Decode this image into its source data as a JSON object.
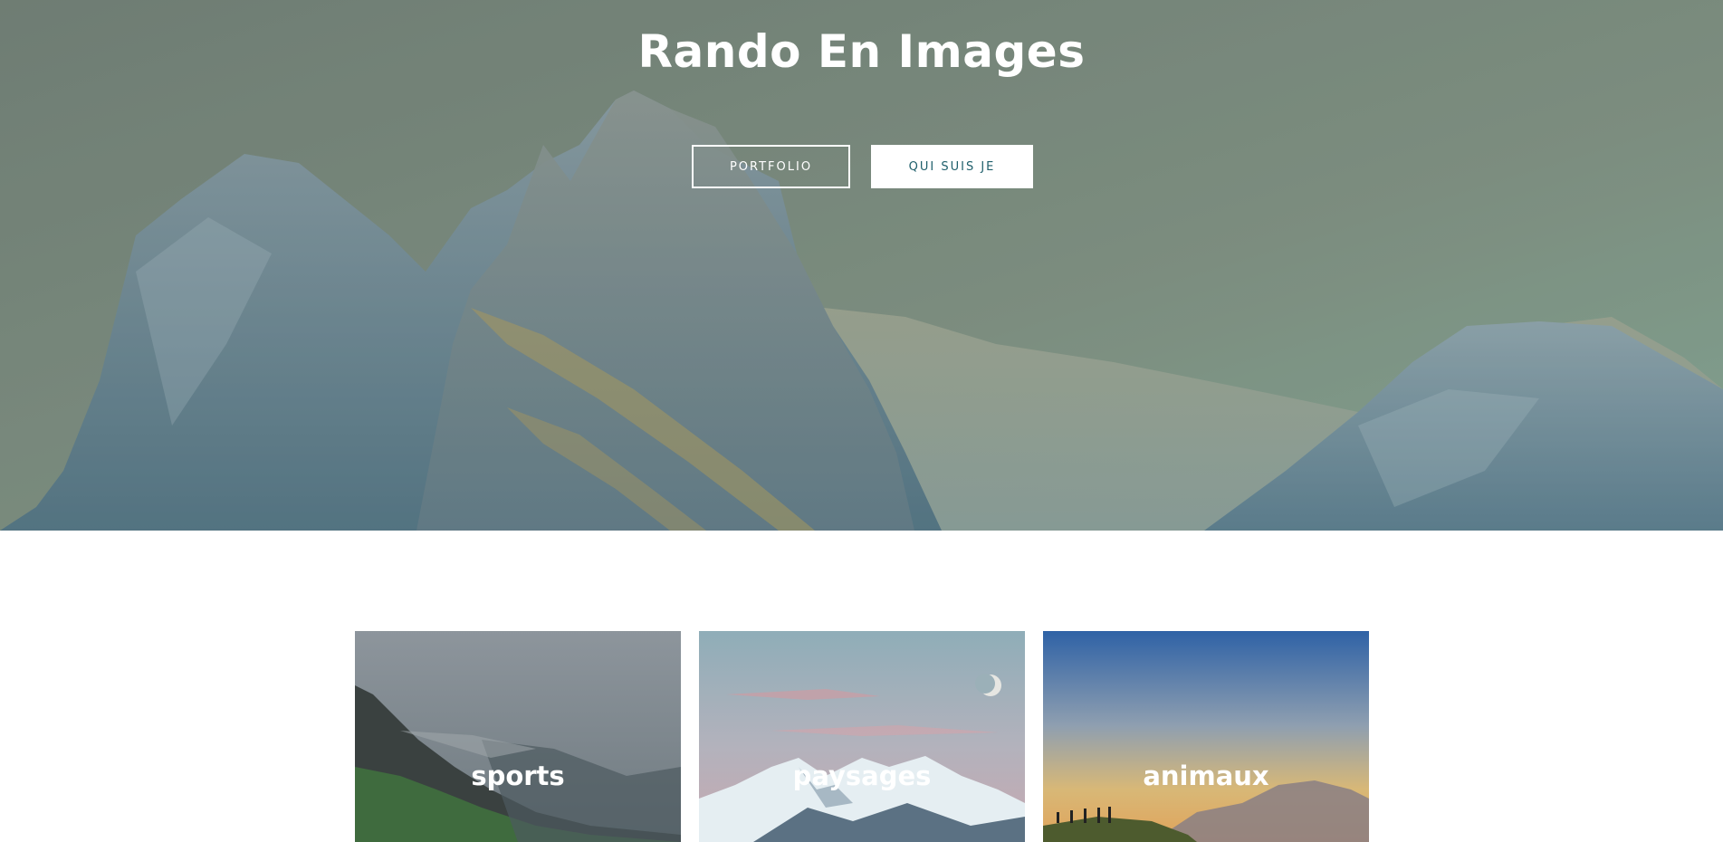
{
  "hero": {
    "title": "Rando En Images",
    "buttons": {
      "portfolio": "PORTFOLIO",
      "qui_suis_je": "QUI SUIS JE"
    }
  },
  "categories": [
    {
      "label": "sports"
    },
    {
      "label": "paysages"
    },
    {
      "label": "animaux"
    }
  ],
  "colors": {
    "hero_overlay": "#7a8f86",
    "button_text_dark": "#1f5f6b",
    "white": "#ffffff"
  }
}
